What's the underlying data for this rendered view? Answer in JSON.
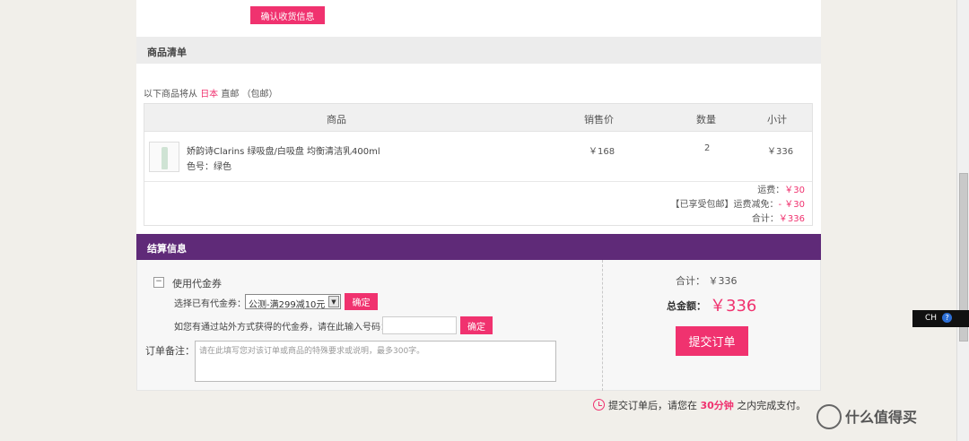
{
  "address": {
    "confirm_label": "确认收货信息"
  },
  "items_section": {
    "title": "商品清单",
    "ship_prefix": "以下商品将从",
    "ship_country": "日本",
    "ship_method": "直邮",
    "ship_note": "（包邮）",
    "columns": [
      "商品",
      "销售价",
      "数量",
      "小计"
    ],
    "products": [
      {
        "name": "娇韵诗Clarins 绿吸盘/白吸盘 均衡清洁乳400ml",
        "color": "色号：绿色",
        "price": "￥168",
        "qty": "2",
        "subtotal": "￥336"
      }
    ],
    "totals": {
      "shipping_label": "运费：",
      "shipping_value": "￥30",
      "free_label": "【已享受包邮】运费减免：",
      "free_value": "- ￥30",
      "sum_label": "合计：",
      "sum_value": "￥336"
    }
  },
  "settlement": {
    "title": "结算信息",
    "coupon_toggle": "−",
    "coupon_label": "使用代金券",
    "select_label": "选择已有代金券：",
    "select_value": "公测-满299减10元",
    "confirm_label": "确定",
    "code_label": "如您有通过站外方式获得的代金券，请在此输入号码：",
    "code_confirm_label": "确定",
    "remark_label": "订单备注：",
    "remark_placeholder": "请在此填写您对该订单或商品的特殊要求或说明，最多300字。",
    "subtotal_text": "合计：  ￥336",
    "total_label": "总金额：",
    "total_value": "￥336",
    "submit_label": "提交订单"
  },
  "notice": {
    "before": "提交订单后，请您在",
    "time": "30分钟",
    "after": "之内完成支付。"
  },
  "ime": {
    "label": "CH",
    "help": "?"
  },
  "watermark": "什么值得买",
  "colors": {
    "accent": "#f0326f",
    "purple": "#5f2a78"
  }
}
